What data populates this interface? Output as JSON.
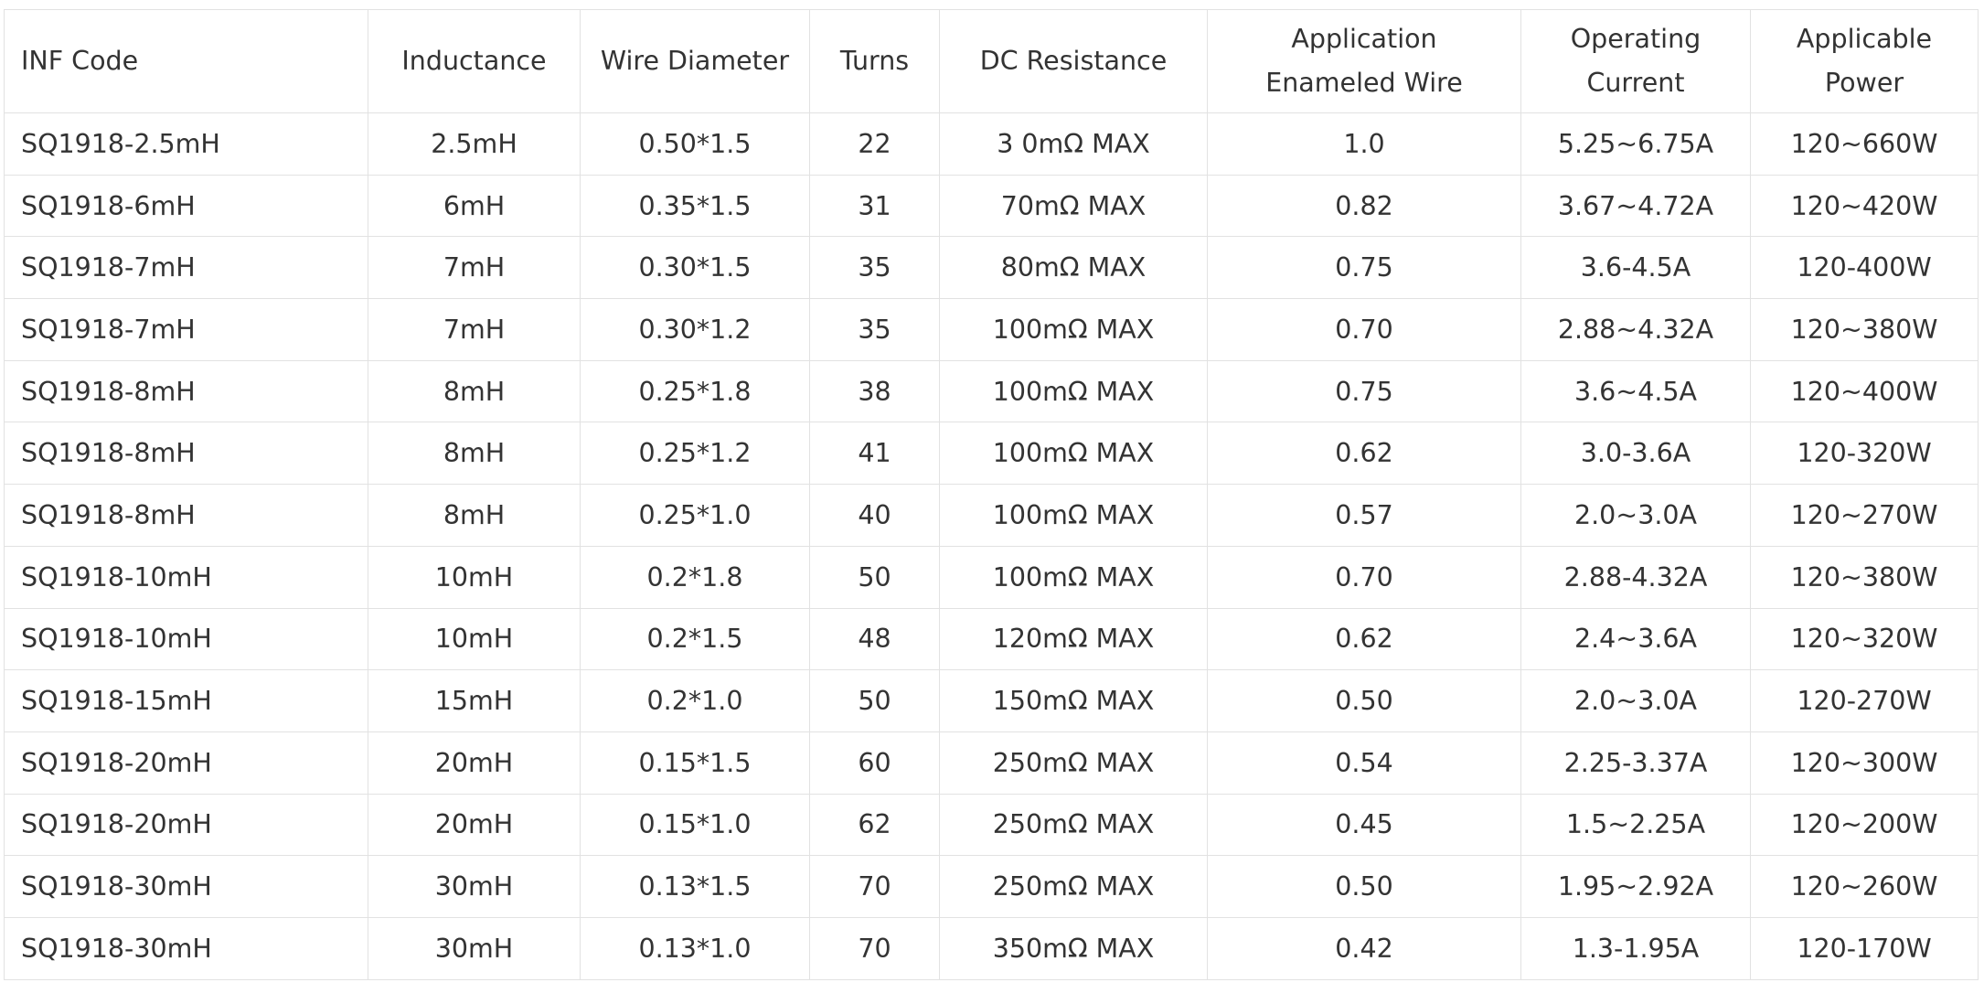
{
  "table": {
    "headers": [
      [
        "INF Code"
      ],
      [
        "Inductance"
      ],
      [
        "Wire Diameter"
      ],
      [
        "Turns"
      ],
      [
        "DC Resistance"
      ],
      [
        "Application",
        "Enameled Wire"
      ],
      [
        "Operating",
        "Current"
      ],
      [
        "Applicable",
        "Power"
      ]
    ],
    "rows": [
      [
        "SQ1918-2.5mH",
        "2.5mH",
        "0.50*1.5",
        "22",
        "3 0mΩ MAX",
        "1.0",
        "5.25~6.75A",
        "120~660W"
      ],
      [
        "SQ1918-6mH",
        "6mH",
        "0.35*1.5",
        "31",
        "70mΩ MAX",
        "0.82",
        "3.67~4.72A",
        "120~420W"
      ],
      [
        "SQ1918-7mH",
        "7mH",
        "0.30*1.5",
        "35",
        "80mΩ MAX",
        "0.75",
        "3.6-4.5A",
        "120-400W"
      ],
      [
        "SQ1918-7mH",
        "7mH",
        "0.30*1.2",
        "35",
        "100mΩ MAX",
        "0.70",
        "2.88~4.32A",
        "120~380W"
      ],
      [
        "SQ1918-8mH",
        "8mH",
        "0.25*1.8",
        "38",
        "100mΩ MAX",
        "0.75",
        "3.6~4.5A",
        "120~400W"
      ],
      [
        "SQ1918-8mH",
        "8mH",
        "0.25*1.2",
        "41",
        "100mΩ MAX",
        "0.62",
        "3.0-3.6A",
        "120-320W"
      ],
      [
        "SQ1918-8mH",
        "8mH",
        "0.25*1.0",
        "40",
        "100mΩ MAX",
        "0.57",
        "2.0~3.0A",
        "120~270W"
      ],
      [
        "SQ1918-10mH",
        "10mH",
        "0.2*1.8",
        "50",
        "100mΩ  MAX",
        "0.70",
        "2.88-4.32A",
        "120~380W"
      ],
      [
        "SQ1918-10mH",
        "10mH",
        "0.2*1.5",
        "48",
        "120mΩ MAX",
        "0.62",
        "2.4~3.6A",
        "120~320W"
      ],
      [
        "SQ1918-15mH",
        "15mH",
        "0.2*1.0",
        "50",
        "150mΩ MAX",
        "0.50",
        "2.0~3.0A",
        "120-270W"
      ],
      [
        "SQ1918-20mH",
        "20mH",
        "0.15*1.5",
        "60",
        "250mΩ MAX",
        "0.54",
        "2.25-3.37A",
        "120~300W"
      ],
      [
        "SQ1918-20mH",
        "20mH",
        "0.15*1.0",
        "62",
        "250mΩ MAX",
        "0.45",
        "1.5~2.25A",
        "120~200W"
      ],
      [
        "SQ1918-30mH",
        "30mH",
        "0.13*1.5",
        "70",
        "250mΩ MAX",
        "0.50",
        "1.95~2.92A",
        "120~260W"
      ],
      [
        "SQ1918-30mH",
        "30mH",
        "0.13*1.0",
        "70",
        "350mΩ MAX",
        "0.42",
        "1.3-1.95A",
        "120-170W"
      ]
    ]
  }
}
